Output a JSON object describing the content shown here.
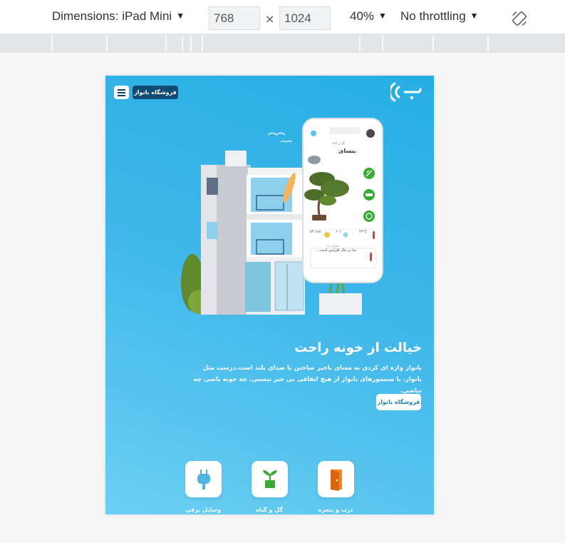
{
  "devtools": {
    "device_label": "Dimensions: iPad Mini",
    "width_value": "768",
    "times": "×",
    "height_value": "1024",
    "zoom_label": "40%",
    "throttle_label": "No throttling",
    "rotate_icon": "rotate-device-icon"
  },
  "site": {
    "store_button": "فروشگاه بانواز",
    "menu_icon": "hamburger-menu-icon",
    "logo_icon": "banavaz-logo-icon",
    "hero": {
      "title": "خیالت از خونه راحت",
      "paragraph": "بانواز واژه ای کردی به معنای باخبر ساختن با صدای بلند است.درست مثل بانواز، با سنسورهای بانواز از هیچ اتفاقی بی خبر نیستی. چه خونه باشی چه نباشی.",
      "cta": "فروشگاه بانواز"
    },
    "phone": {
      "category": "گل و گیاه",
      "plant_name": "بنسای",
      "temp": "۲۳°C",
      "humidity": "۶۰٪",
      "light": "۸۳۰lux",
      "alert_title": "هشدار دما",
      "alert_text": "دما در حال افزایش است..."
    },
    "categories": [
      {
        "label": "درب و پنجره",
        "icon": "door-icon"
      },
      {
        "label": "گل و گیاه",
        "icon": "plant-icon"
      },
      {
        "label": "وسایل برقی",
        "icon": "plug-icon"
      }
    ],
    "colors": {
      "primary": "#27aee4",
      "dark": "#0f4c73",
      "accent_orange": "#f58220",
      "accent_green": "#3aaa35"
    }
  }
}
